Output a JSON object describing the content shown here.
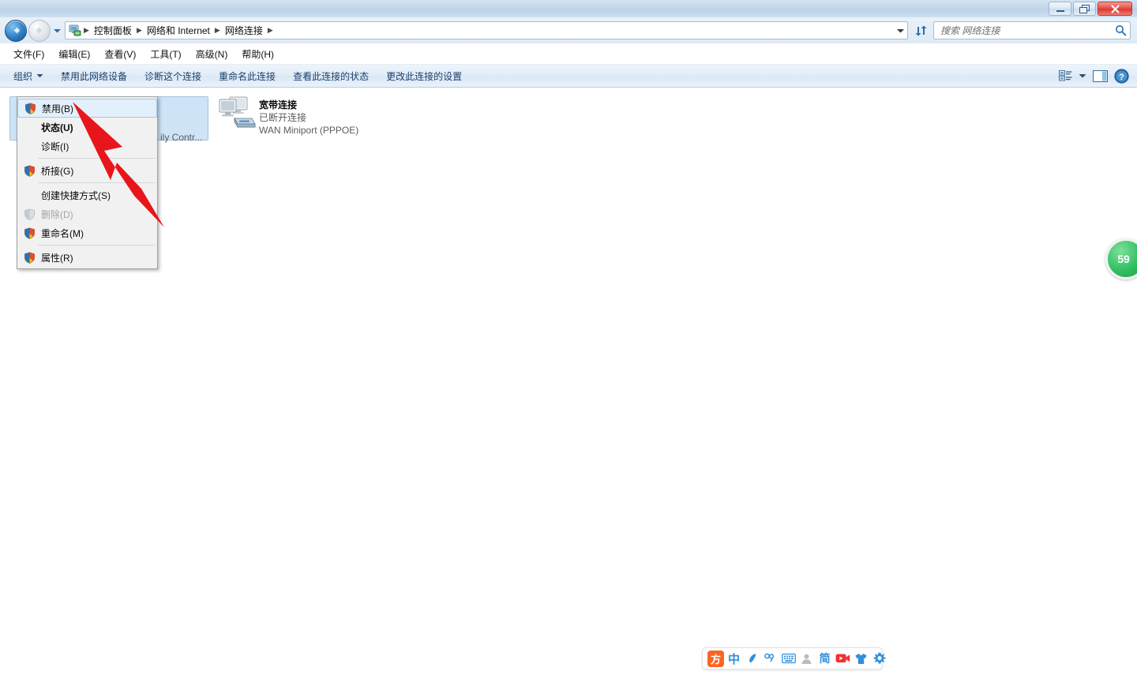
{
  "window": {
    "buttons": {
      "minimize": "minimize",
      "maximize": "maximize",
      "close": "close"
    }
  },
  "address": {
    "icon": "network-connections-icon",
    "breadcrumbs": [
      "控制面板",
      "网络和 Internet",
      "网络连接"
    ],
    "separator": "▶",
    "dropdown_icon": "chevron-down-icon",
    "refresh_icon": "refresh-icon"
  },
  "search": {
    "placeholder": "搜索 网络连接",
    "icon": "search-icon"
  },
  "menubar": {
    "items": [
      {
        "label": "文件(F)"
      },
      {
        "label": "编辑(E)"
      },
      {
        "label": "查看(V)"
      },
      {
        "label": "工具(T)"
      },
      {
        "label": "高级(N)"
      },
      {
        "label": "帮助(H)"
      }
    ]
  },
  "toolbar": {
    "items": [
      {
        "label": "组织",
        "has_arrow": true
      },
      {
        "label": "禁用此网络设备",
        "has_arrow": false
      },
      {
        "label": "诊断这个连接",
        "has_arrow": false
      },
      {
        "label": "重命名此连接",
        "has_arrow": false
      },
      {
        "label": "查看此连接的状态",
        "has_arrow": false
      },
      {
        "label": "更改此连接的设置",
        "has_arrow": false
      }
    ],
    "right_icons": [
      {
        "name": "view-options-icon"
      },
      {
        "name": "chevron-down-icon"
      },
      {
        "name": "preview-pane-icon"
      },
      {
        "name": "help-icon"
      }
    ]
  },
  "connections": [
    {
      "name": "",
      "status": "",
      "device": "ily Contr...",
      "icon": "network-adapter-icon",
      "selected": true,
      "occluded": true
    },
    {
      "name": "宽带连接",
      "status": "已断开连接",
      "device": "WAN Miniport (PPPOE)",
      "icon": "broadband-connection-icon",
      "selected": false,
      "occluded": false
    }
  ],
  "context_menu": {
    "items": [
      {
        "label": "禁用(B)",
        "icon": "uac-shield-icon",
        "bold": false,
        "disabled": false,
        "hovered": true,
        "separator_after": false
      },
      {
        "label": "状态(U)",
        "icon": null,
        "bold": true,
        "disabled": false,
        "hovered": false,
        "separator_after": false
      },
      {
        "label": "诊断(I)",
        "icon": null,
        "bold": false,
        "disabled": false,
        "hovered": false,
        "separator_after": true
      },
      {
        "label": "桥接(G)",
        "icon": "uac-shield-icon",
        "bold": false,
        "disabled": false,
        "hovered": false,
        "separator_after": true
      },
      {
        "label": "创建快捷方式(S)",
        "icon": null,
        "bold": false,
        "disabled": false,
        "hovered": false,
        "separator_after": false
      },
      {
        "label": "删除(D)",
        "icon": "uac-shield-disabled-icon",
        "bold": false,
        "disabled": true,
        "hovered": false,
        "separator_after": false
      },
      {
        "label": "重命名(M)",
        "icon": "uac-shield-icon",
        "bold": false,
        "disabled": false,
        "hovered": false,
        "separator_after": true
      },
      {
        "label": "属性(R)",
        "icon": "uac-shield-icon",
        "bold": false,
        "disabled": false,
        "hovered": false,
        "separator_after": false
      }
    ]
  },
  "annotation": {
    "arrow_color": "#e8151b",
    "points_to": "禁用(B)"
  },
  "side_badge": {
    "value": "59",
    "color": "#34bf63"
  },
  "ime_bar": {
    "items": [
      {
        "name": "sogou-logo-icon",
        "label": "方"
      },
      {
        "name": "chinese-mode-icon",
        "label": "中"
      },
      {
        "name": "moon-icon",
        "label": ""
      },
      {
        "name": "punctuation-icon",
        "label": "°,"
      },
      {
        "name": "keyboard-icon",
        "label": ""
      },
      {
        "name": "user-icon",
        "label": ""
      },
      {
        "name": "simplified-icon",
        "label": "简"
      },
      {
        "name": "video-icon",
        "label": ""
      },
      {
        "name": "skin-icon",
        "label": ""
      },
      {
        "name": "settings-gear-icon",
        "label": ""
      }
    ]
  }
}
